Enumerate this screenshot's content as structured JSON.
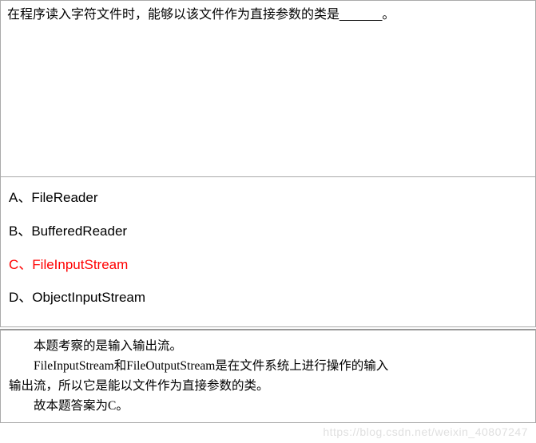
{
  "question": {
    "text": "在程序读入字符文件时，能够以该文件作为直接参数的类是______。"
  },
  "options": [
    {
      "label": "A、",
      "text": "FileReader",
      "highlighted": false
    },
    {
      "label": "B、",
      "text": "BufferedReader",
      "highlighted": false
    },
    {
      "label": "C、",
      "text": "FileInputStream",
      "highlighted": true
    },
    {
      "label": "D、",
      "text": "ObjectInputStream",
      "highlighted": false
    }
  ],
  "explanation": {
    "line1": "本题考察的是输入输出流。",
    "line2a": "FileInputStream和FileOutputStream是在文件系统上进行操作的输入",
    "line2b": "输出流，所以它是能以文件作为直接参数的类。",
    "line3": "故本题答案为C。"
  },
  "watermark": "https://blog.csdn.net/weixin_40807247"
}
